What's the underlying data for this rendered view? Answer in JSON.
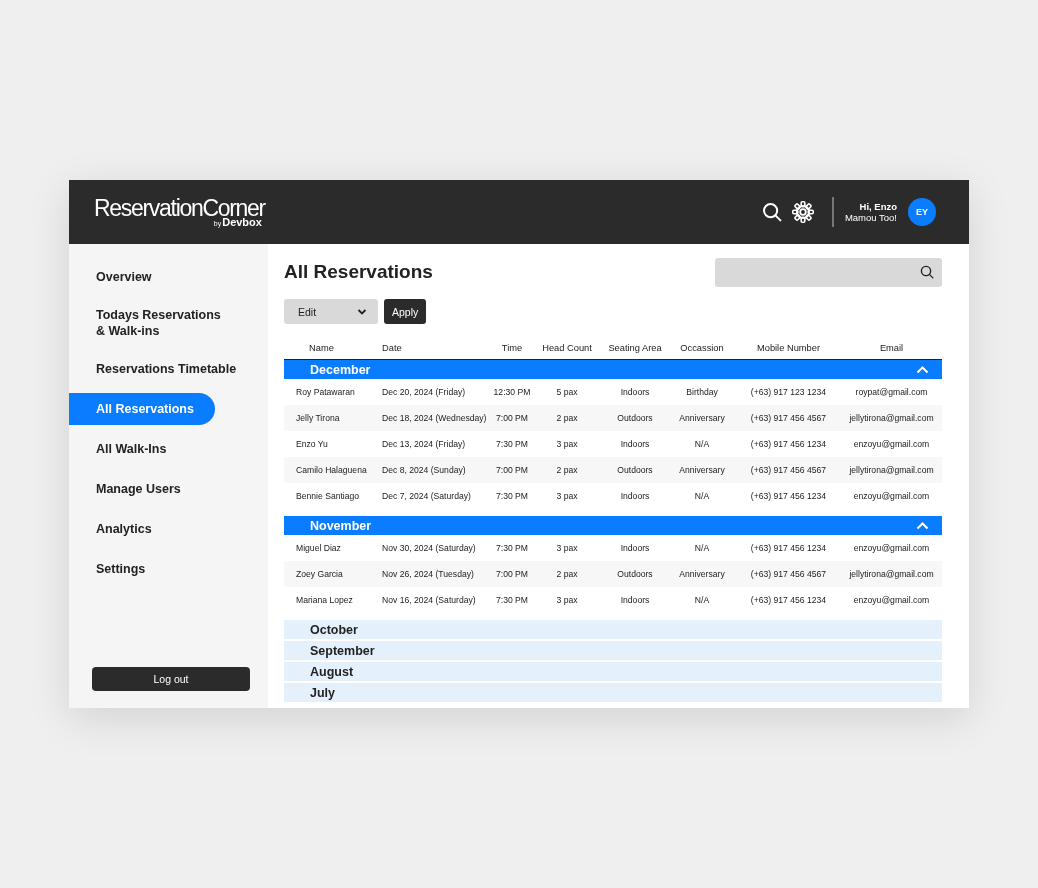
{
  "header": {
    "logo": {
      "name": "ReservationCorner",
      "by": "by",
      "brand": "Devbox"
    },
    "greeting": "Hi, Enzo",
    "user_name": "Mamou Too!",
    "avatar_initials": "EY"
  },
  "sidebar": {
    "items": [
      {
        "label": "Overview",
        "selected": false
      },
      {
        "label": "Todays Reservations\n& Walk-ins",
        "selected": false
      },
      {
        "label": "Reservations Timetable",
        "selected": false
      },
      {
        "label": "All Reservations",
        "selected": true
      },
      {
        "label": "All Walk-Ins",
        "selected": false
      },
      {
        "label": "Manage Users",
        "selected": false
      },
      {
        "label": "Analytics",
        "selected": false
      },
      {
        "label": "Settings",
        "selected": false
      }
    ],
    "logout_button": "Log out"
  },
  "page": {
    "title": "All Reservations",
    "bulk_action": {
      "value": "Edit"
    },
    "apply_button": "Apply"
  },
  "table": {
    "columns": [
      "Name",
      "Date",
      "Time",
      "Head Count",
      "Seating Area",
      "Occassion",
      "Mobile Number",
      "Email"
    ],
    "groups": [
      {
        "month": "December",
        "expanded": true,
        "rows": [
          [
            "Roy Patawaran",
            "Dec 20, 2024 (Friday)",
            "12:30 PM",
            "5 pax",
            "Indoors",
            "Birthday",
            "(+63) 917 123 1234",
            "roypat@gmail.com"
          ],
          [
            "Jelly Tirona",
            "Dec 18, 2024 (Wednesday)",
            "7:00 PM",
            "2 pax",
            "Outdoors",
            "Anniversary",
            "(+63) 917 456 4567",
            "jellytirona@gmail.com"
          ],
          [
            "Enzo Yu",
            "Dec 13, 2024 (Friday)",
            "7:30 PM",
            "3 pax",
            "Indoors",
            "N/A",
            "(+63) 917 456 1234",
            "enzoyu@gmail.com"
          ],
          [
            "Camilo Halaguena",
            "Dec 8, 2024 (Sunday)",
            "7:00 PM",
            "2 pax",
            "Outdoors",
            "Anniversary",
            "(+63) 917 456 4567",
            "jellytirona@gmail.com"
          ],
          [
            "Bennie Santiago",
            "Dec 7, 2024 (Saturday)",
            "7:30 PM",
            "3 pax",
            "Indoors",
            "N/A",
            "(+63) 917 456 1234",
            "enzoyu@gmail.com"
          ]
        ]
      },
      {
        "month": "November",
        "expanded": true,
        "rows": [
          [
            "Miguel Diaz",
            "Nov 30, 2024 (Saturday)",
            "7:30 PM",
            "3 pax",
            "Indoors",
            "N/A",
            "(+63) 917 456 1234",
            "enzoyu@gmail.com"
          ],
          [
            "Zoey Garcia",
            "Nov 26, 2024 (Tuesday)",
            "7:00 PM",
            "2 pax",
            "Outdoors",
            "Anniversary",
            "(+63) 917 456 4567",
            "jellytirona@gmail.com"
          ],
          [
            "Mariana Lopez",
            "Nov 16, 2024 (Saturday)",
            "7:30 PM",
            "3 pax",
            "Indoors",
            "N/A",
            "(+63) 917 456 1234",
            "enzoyu@gmail.com"
          ]
        ]
      },
      {
        "month": "October",
        "expanded": false
      },
      {
        "month": "September",
        "expanded": false
      },
      {
        "month": "August",
        "expanded": false
      },
      {
        "month": "July",
        "expanded": false
      }
    ]
  }
}
